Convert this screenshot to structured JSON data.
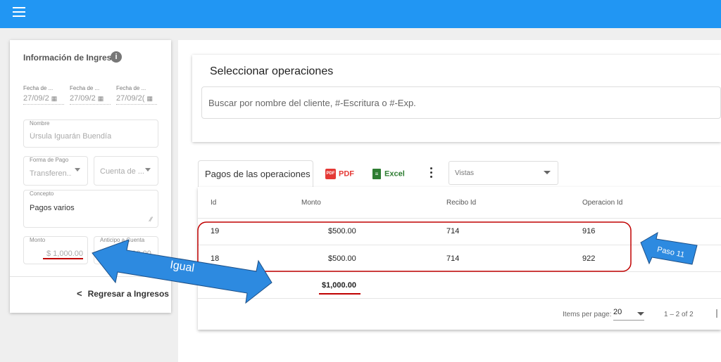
{
  "app": {
    "menu_icon": "hamburger-menu-icon",
    "primary_color": "#2196f3"
  },
  "ingreso": {
    "title": "Información de Ingreso",
    "info_icon": "info-icon",
    "dates": [
      {
        "label": "Fecha de ...",
        "value": "27/09/2"
      },
      {
        "label": "Fecha de ...",
        "value": "27/09/2"
      },
      {
        "label": "Fecha de ...",
        "value": "27/09/2("
      }
    ],
    "nombre": {
      "label": "Nombre",
      "value": "Úrsula  Iguarán  Buendía"
    },
    "forma_pago": {
      "label": "Forma de Pago",
      "value": "Transferen..."
    },
    "cuenta": {
      "value": "Cuenta de ..."
    },
    "concepto": {
      "label": "Concepto",
      "value": "Pagos varios"
    },
    "monto": {
      "label": "Monto",
      "value": "$ 1,000.00"
    },
    "anticipo": {
      "label": "Anticipo a Cuenta",
      "value": "1,000.00"
    },
    "back_label": "Regresar a Ingresos"
  },
  "seleccionar": {
    "title": "Seleccionar operaciones",
    "search_placeholder": "Buscar por nombre del cliente, #-Escritura o #-Exp."
  },
  "pagos": {
    "tab_label": "Pagos de las operaciones",
    "pdf_label": "PDF",
    "excel_label": "Excel",
    "vistas_placeholder": "Vistas",
    "columns": [
      "Id",
      "Monto",
      "Recibo Id",
      "Operacion Id"
    ],
    "rows": [
      {
        "id": "19",
        "monto": "$500.00",
        "recibo": "714",
        "operacion": "916"
      },
      {
        "id": "18",
        "monto": "$500.00",
        "recibo": "714",
        "operacion": "922"
      }
    ],
    "total": "$1,000.00",
    "items_per_page_label": "Items per page:",
    "items_per_page_value": "20",
    "range_label": "1 – 2 of 2"
  },
  "annotations": {
    "igual_label": "Igual",
    "paso_label": "Paso 11",
    "arrow_color": "#2d8ae0",
    "highlight_color": "#c00000"
  }
}
